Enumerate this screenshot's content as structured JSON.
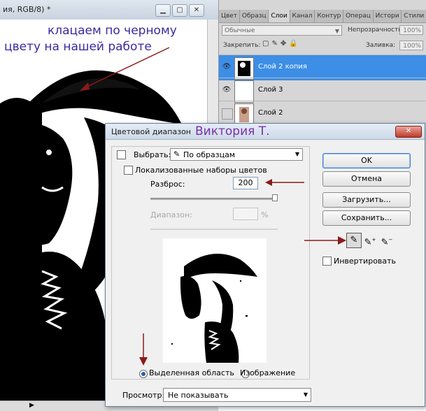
{
  "doc_window": {
    "title": "ия, RGB/8) *",
    "btn_min": "▁",
    "btn_max": "▢",
    "btn_close": "✕"
  },
  "panel": {
    "tabs": [
      "Цвет",
      "Образц",
      "Слои",
      "Канал",
      "Контур",
      "Операц",
      "Истори",
      "Стили"
    ],
    "active_tab_index": 2,
    "blend_mode": "Обычные",
    "opacity_label": "Непрозрачность:",
    "opacity_value": "100%",
    "lock_label": "Закрепить:",
    "fill_label": "Заливка:",
    "fill_value": "100%",
    "layers": [
      {
        "name": "Слой 2 копия",
        "visible": true,
        "selected": true
      },
      {
        "name": "Слой 3",
        "visible": true,
        "selected": false
      },
      {
        "name": "Слой 2",
        "visible": false,
        "selected": false
      }
    ]
  },
  "dialog": {
    "title": "Цветовой диапазон",
    "close": "✕",
    "select_label": "Выбрать:",
    "select_value": "По образцам",
    "localized_label": "Локализованные наборы цветов",
    "fuzziness_label": "Разброс:",
    "fuzziness_value": "200",
    "range_label": "Диапазон:",
    "range_unit": "%",
    "radio_selection": "Выделенная область",
    "radio_image": "Изображение",
    "preview_label": "Просмотр:",
    "preview_value": "Не показывать",
    "btn_ok": "OK",
    "btn_cancel": "Отмена",
    "btn_load": "Загрузить...",
    "btn_save": "Сохранить...",
    "invert_label": "Инвертировать",
    "fuzziness_level_percent": 100
  },
  "annotations": {
    "click_black_line1": "клацаем по черному",
    "click_black_line2": "цвету на нашей работе",
    "author": "Виктория Т."
  },
  "colors": {
    "selected_layer": "#3d8ee6",
    "annotation_blue": "#3a2aa0",
    "arrow_red": "#8b1a1a",
    "author_purple": "#7b2fa8"
  }
}
